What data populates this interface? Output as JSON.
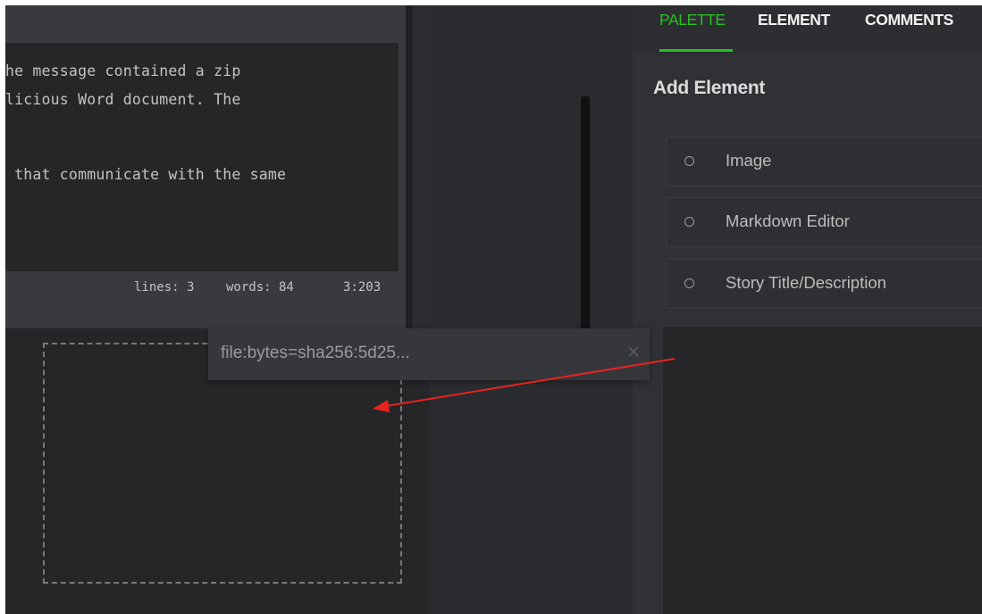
{
  "editor": {
    "lines": [
      "he message contained a zip",
      "licious Word document. The",
      " that communicate with the same"
    ],
    "status": {
      "lines": "lines: 3",
      "words": "words: 84",
      "cursor": "3:203"
    }
  },
  "tooltip": {
    "text": "file:bytes=sha256:5d25..."
  },
  "tabs": [
    {
      "label": "PALETTE",
      "active": true
    },
    {
      "label": "ELEMENT",
      "active": false
    },
    {
      "label": "COMMENTS",
      "active": false
    }
  ],
  "sidebar": {
    "heading": "Add Element",
    "items": [
      {
        "label": "Image",
        "icon": "radio-circle-icon"
      },
      {
        "label": "Markdown Editor",
        "icon": "radio-circle-icon"
      },
      {
        "label": "Story Title/Description",
        "icon": "radio-circle-icon"
      }
    ]
  },
  "colors": {
    "accent": "#26c11e",
    "annotation_arrow": "#e8231f"
  }
}
